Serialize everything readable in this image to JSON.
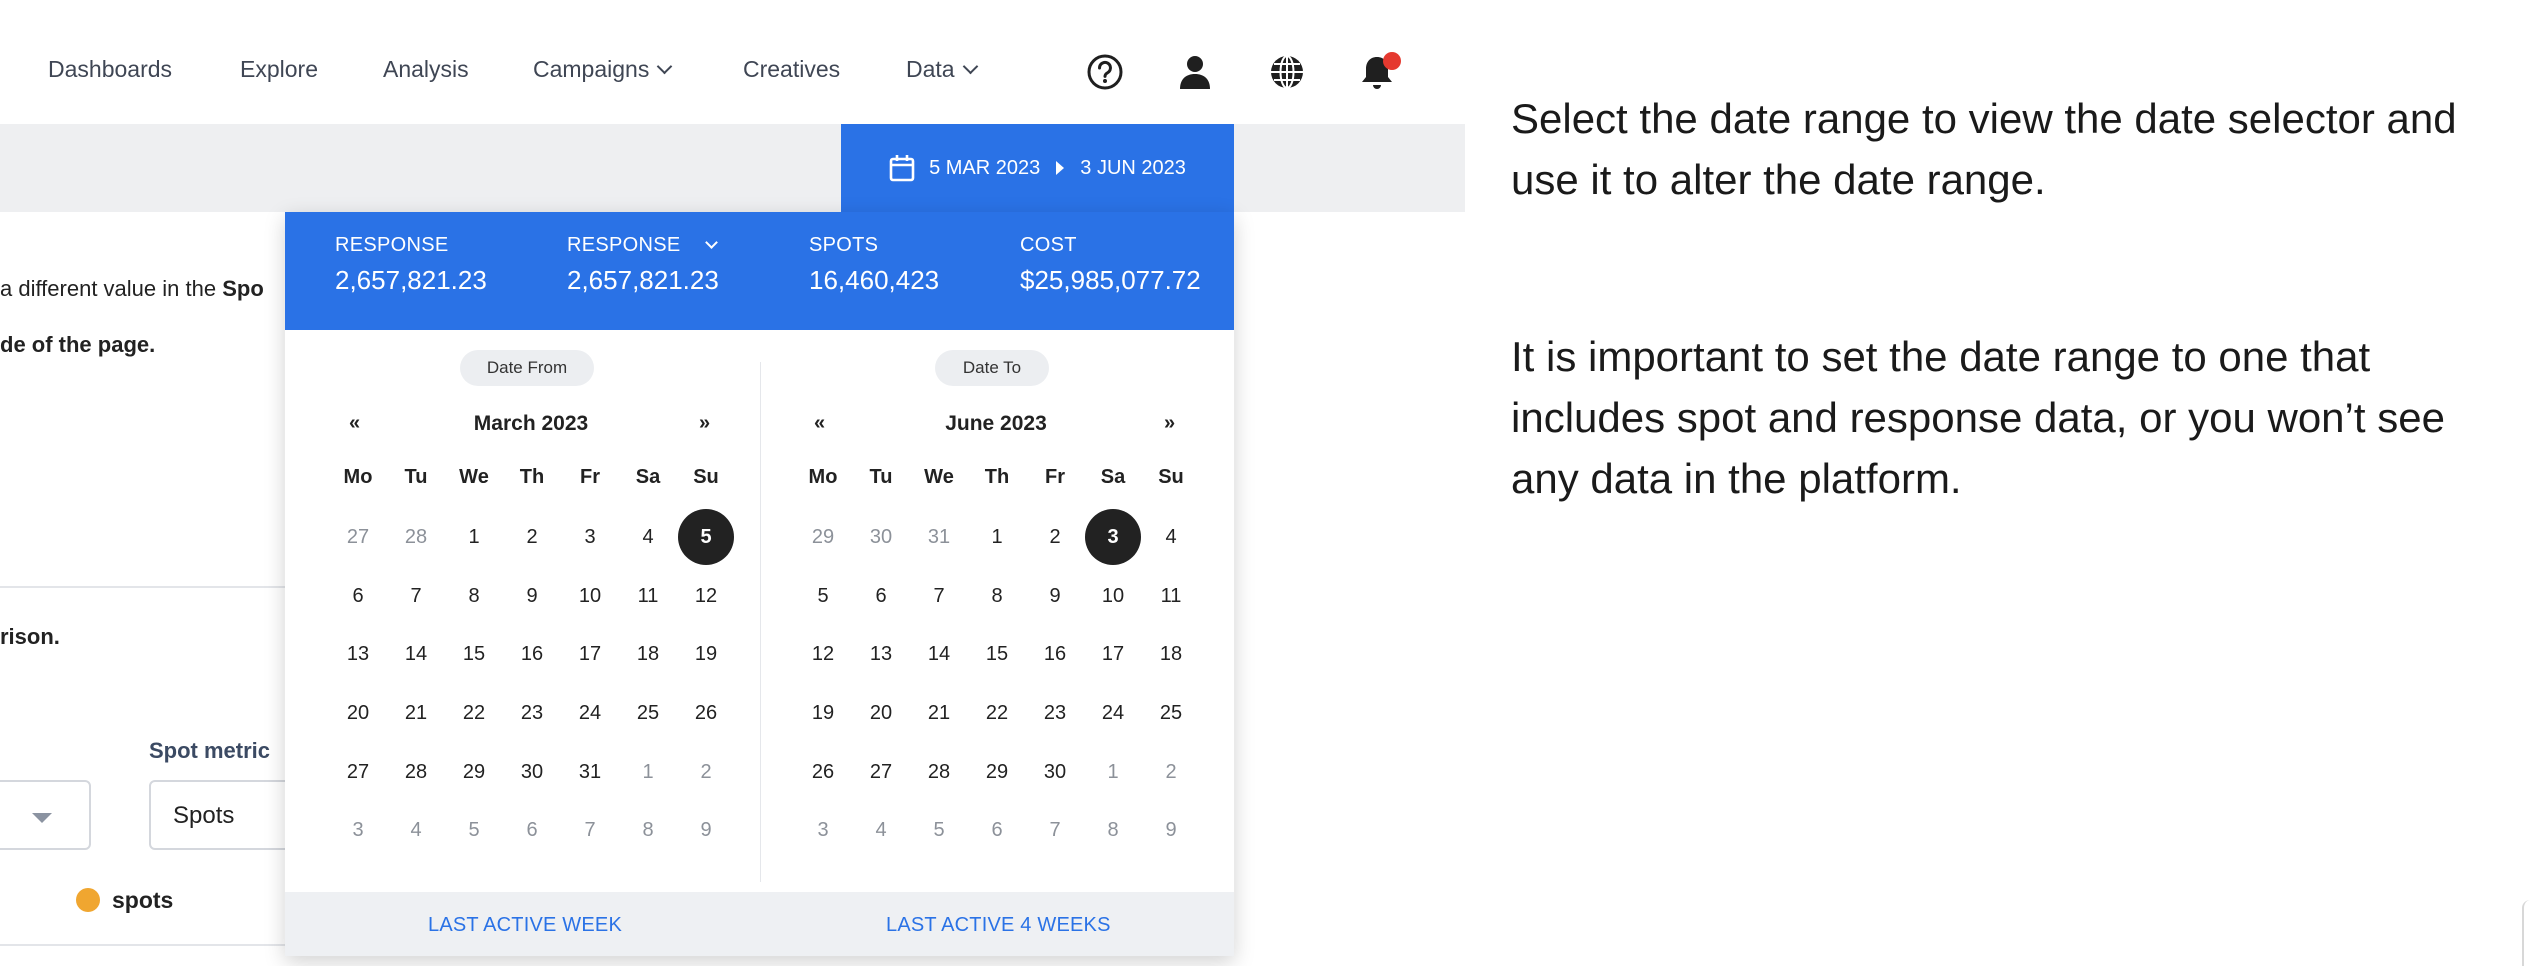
{
  "nav": {
    "items": [
      {
        "label": "Dashboards"
      },
      {
        "label": "Explore"
      },
      {
        "label": "Analysis"
      },
      {
        "label": "Campaigns",
        "dropdown": true
      },
      {
        "label": "Creatives"
      },
      {
        "label": "Data",
        "dropdown": true
      }
    ],
    "icons": [
      "help-icon",
      "user-icon",
      "globe-icon",
      "bell-icon"
    ],
    "notification_badge_color": "#e5392f"
  },
  "background": {
    "line1_prefix": "a different value in the ",
    "line1_bold": "Spo",
    "line2": "de of the page.",
    "line3": "rison.",
    "spot_metric_label": "Spot metric",
    "spot_metric_value": "Spots",
    "legend_label": "spots",
    "legend_color": "#f0a630"
  },
  "date_range": {
    "from": "5 MAR 2023",
    "to": "3 JUN 2023"
  },
  "metrics": [
    {
      "label": "RESPONSE",
      "value": "2,657,821.23",
      "dropdown": false
    },
    {
      "label": "RESPONSE",
      "value": "2,657,821.23",
      "dropdown": true
    },
    {
      "label": "SPOTS",
      "value": "16,460,423",
      "dropdown": false
    },
    {
      "label": "COST",
      "value": "$25,985,077.72",
      "dropdown": false
    }
  ],
  "calendars": {
    "dow": [
      "Mo",
      "Tu",
      "We",
      "Th",
      "Fr",
      "Sa",
      "Su"
    ],
    "prev_label": "«",
    "next_label": "»",
    "from": {
      "pill": "Date From",
      "title": "March 2023",
      "selected": "5",
      "weeks": [
        [
          [
            "27",
            1
          ],
          [
            "28",
            1
          ],
          [
            "1",
            0
          ],
          [
            "2",
            0
          ],
          [
            "3",
            0
          ],
          [
            "4",
            0
          ],
          [
            "5",
            0
          ]
        ],
        [
          [
            "6",
            0
          ],
          [
            "7",
            0
          ],
          [
            "8",
            0
          ],
          [
            "9",
            0
          ],
          [
            "10",
            0
          ],
          [
            "11",
            0
          ],
          [
            "12",
            0
          ]
        ],
        [
          [
            "13",
            0
          ],
          [
            "14",
            0
          ],
          [
            "15",
            0
          ],
          [
            "16",
            0
          ],
          [
            "17",
            0
          ],
          [
            "18",
            0
          ],
          [
            "19",
            0
          ]
        ],
        [
          [
            "20",
            0
          ],
          [
            "21",
            0
          ],
          [
            "22",
            0
          ],
          [
            "23",
            0
          ],
          [
            "24",
            0
          ],
          [
            "25",
            0
          ],
          [
            "26",
            0
          ]
        ],
        [
          [
            "27",
            0
          ],
          [
            "28",
            0
          ],
          [
            "29",
            0
          ],
          [
            "30",
            0
          ],
          [
            "31",
            0
          ],
          [
            "1",
            1
          ],
          [
            "2",
            1
          ]
        ],
        [
          [
            "3",
            1
          ],
          [
            "4",
            1
          ],
          [
            "5",
            1
          ],
          [
            "6",
            1
          ],
          [
            "7",
            1
          ],
          [
            "8",
            1
          ],
          [
            "9",
            1
          ]
        ]
      ]
    },
    "to": {
      "pill": "Date To",
      "title": "June 2023",
      "selected": "3",
      "weeks": [
        [
          [
            "29",
            1
          ],
          [
            "30",
            1
          ],
          [
            "31",
            1
          ],
          [
            "1",
            0
          ],
          [
            "2",
            0
          ],
          [
            "3",
            0
          ],
          [
            "4",
            0
          ]
        ],
        [
          [
            "5",
            0
          ],
          [
            "6",
            0
          ],
          [
            "7",
            0
          ],
          [
            "8",
            0
          ],
          [
            "9",
            0
          ],
          [
            "10",
            0
          ],
          [
            "11",
            0
          ]
        ],
        [
          [
            "12",
            0
          ],
          [
            "13",
            0
          ],
          [
            "14",
            0
          ],
          [
            "15",
            0
          ],
          [
            "16",
            0
          ],
          [
            "17",
            0
          ],
          [
            "18",
            0
          ]
        ],
        [
          [
            "19",
            0
          ],
          [
            "20",
            0
          ],
          [
            "21",
            0
          ],
          [
            "22",
            0
          ],
          [
            "23",
            0
          ],
          [
            "24",
            0
          ],
          [
            "25",
            0
          ]
        ],
        [
          [
            "26",
            0
          ],
          [
            "27",
            0
          ],
          [
            "28",
            0
          ],
          [
            "29",
            0
          ],
          [
            "30",
            0
          ],
          [
            "1",
            1
          ],
          [
            "2",
            1
          ]
        ],
        [
          [
            "3",
            1
          ],
          [
            "4",
            1
          ],
          [
            "5",
            1
          ],
          [
            "6",
            1
          ],
          [
            "7",
            1
          ],
          [
            "8",
            1
          ],
          [
            "9",
            1
          ]
        ]
      ]
    }
  },
  "footer": {
    "last_week": "LAST ACTIVE WEEK",
    "last_4_weeks": "LAST ACTIVE 4 WEEKS"
  },
  "instructions": {
    "p1": "Select the date range to view the date selector and use it to alter the date range.",
    "p2": "It is important to set the date range to one that includes spot and response data, or you won’t see any data in the platform."
  },
  "colors": {
    "accent": "#2a72e6",
    "selected_day": "#222222"
  }
}
